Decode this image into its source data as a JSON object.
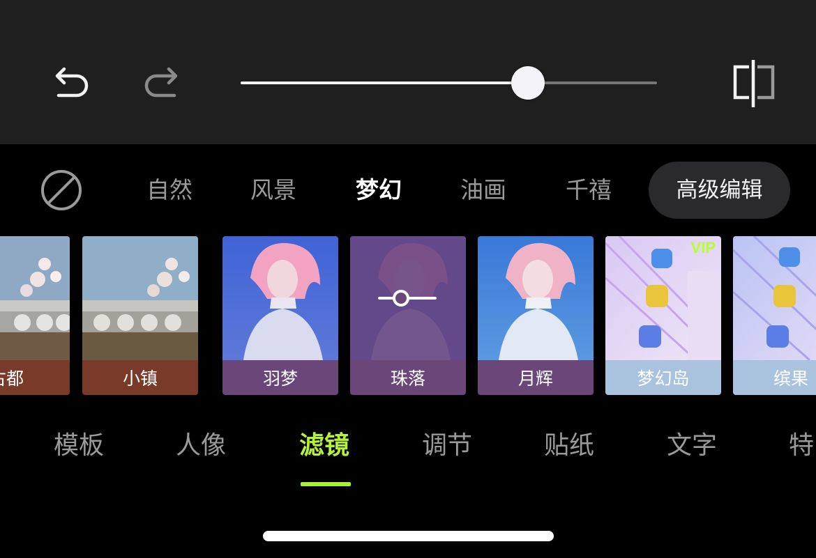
{
  "toolbar": {
    "undo_icon": "undo-arrow",
    "redo_icon": "redo-arrow",
    "compare_icon": "split-compare",
    "intensity": 0.69
  },
  "categories": {
    "none_icon": "no-filter-slash-circle",
    "items": [
      {
        "label": "自然"
      },
      {
        "label": "风景"
      },
      {
        "label": "梦幻"
      },
      {
        "label": "油画"
      },
      {
        "label": "千禧"
      }
    ],
    "selected": "梦幻",
    "advanced_label": "高级编辑"
  },
  "filters": [
    {
      "label": "古都",
      "label_color": "#7a3a2a"
    },
    {
      "label": "小镇",
      "label_color": "#7a3a2a"
    },
    {
      "label": "羽梦",
      "label_color": "#6b4679"
    },
    {
      "label": "珠落",
      "label_color": "#6b4679",
      "selected": true
    },
    {
      "label": "月辉",
      "label_color": "#6b4679"
    },
    {
      "label": "梦幻岛",
      "label_color": "#a9c3de",
      "badge": "VIP"
    },
    {
      "label": "缤果",
      "label_color": "#a9c3de"
    }
  ],
  "tabs": {
    "items": [
      {
        "label": "模板"
      },
      {
        "label": "人像"
      },
      {
        "label": "滤镜"
      },
      {
        "label": "调节"
      },
      {
        "label": "贴纸"
      },
      {
        "label": "文字"
      },
      {
        "label": "特"
      }
    ],
    "selected": "滤镜",
    "accent": "#b5f23a"
  }
}
